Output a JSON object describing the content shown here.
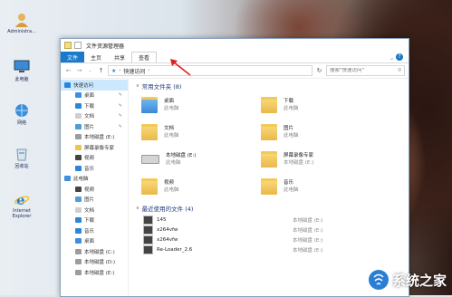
{
  "desktop": {
    "icons": [
      {
        "label": "Administra...",
        "icon": "user-icon"
      },
      {
        "label": "此电脑",
        "icon": "computer-icon"
      },
      {
        "label": "网络",
        "icon": "network-icon"
      },
      {
        "label": "回收站",
        "icon": "recycle-bin-icon"
      },
      {
        "label": "Internet Explorer",
        "icon": "ie-icon"
      }
    ]
  },
  "window": {
    "title": "文件资源管理器",
    "ribbon_tabs": [
      "文件",
      "主页",
      "共享",
      "查看"
    ],
    "address": {
      "location": "快速访问"
    },
    "search": {
      "placeholder": "搜索\"快速访问\""
    }
  },
  "nav": {
    "items": [
      {
        "label": "快速访问",
        "level": 0,
        "color": "#2b86d8"
      },
      {
        "label": "桌面",
        "level": 1,
        "color": "#3d8fe0",
        "pinned": true
      },
      {
        "label": "下载",
        "level": 1,
        "color": "#2b86d8",
        "pinned": true
      },
      {
        "label": "文档",
        "level": 1,
        "color": "#cfcfcf",
        "pinned": true
      },
      {
        "label": "图片",
        "level": 1,
        "color": "#4f9ed8",
        "pinned": true
      },
      {
        "label": "本地磁盘 (E:)",
        "level": 1,
        "color": "#9c9c9c"
      },
      {
        "label": "屏幕录像专家",
        "level": 1,
        "color": "#f0c24f"
      },
      {
        "label": "视频",
        "level": 1,
        "color": "#444"
      },
      {
        "label": "音乐",
        "level": 1,
        "color": "#2b86d8"
      },
      {
        "label": "此电脑",
        "level": 0,
        "color": "#3d8fe0"
      },
      {
        "label": "视频",
        "level": 1,
        "color": "#444"
      },
      {
        "label": "图片",
        "level": 1,
        "color": "#4f9ed8"
      },
      {
        "label": "文档",
        "level": 1,
        "color": "#cfcfcf"
      },
      {
        "label": "下载",
        "level": 1,
        "color": "#2b86d8"
      },
      {
        "label": "音乐",
        "level": 1,
        "color": "#2b86d8"
      },
      {
        "label": "桌面",
        "level": 1,
        "color": "#3d8fe0"
      },
      {
        "label": "本地磁盘 (C:)",
        "level": 1,
        "color": "#9c9c9c"
      },
      {
        "label": "本地磁盘 (D:)",
        "level": 1,
        "color": "#9c9c9c"
      },
      {
        "label": "本地磁盘 (E:)",
        "level": 1,
        "color": "#9c9c9c"
      }
    ]
  },
  "content": {
    "frequent_title": "常用文件夹 (8)",
    "frequent": [
      {
        "name": "桌面",
        "loc": "此电脑",
        "kind": "folder-blue"
      },
      {
        "name": "下载",
        "loc": "此电脑",
        "kind": "folder-download"
      },
      {
        "name": "文档",
        "loc": "此电脑",
        "kind": "folder-docs"
      },
      {
        "name": "图片",
        "loc": "此电脑",
        "kind": "folder-pictures"
      },
      {
        "name": "本地磁盘 (E:)",
        "loc": "此电脑",
        "kind": "drive"
      },
      {
        "name": "屏幕录像专家",
        "loc": "本地磁盘 (E:)",
        "kind": "folder"
      },
      {
        "name": "视频",
        "loc": "此电脑",
        "kind": "folder-videos"
      },
      {
        "name": "音乐",
        "loc": "此电脑",
        "kind": "folder-music"
      }
    ],
    "recent_title": "最近使用的文件 (4)",
    "recent": [
      {
        "name": "145",
        "loc": "本地磁盘 (E:)"
      },
      {
        "name": "x264vfw",
        "loc": "本地磁盘 (E:)"
      },
      {
        "name": "x264vfw",
        "loc": "本地磁盘 (E:)"
      },
      {
        "name": "Re-Loader_2.6",
        "loc": "本地磁盘 (E:)"
      }
    ]
  },
  "watermark": {
    "text": "系统之家"
  }
}
